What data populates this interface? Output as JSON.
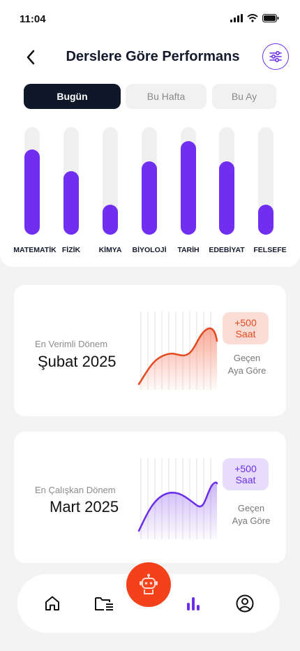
{
  "status_bar": {
    "time": "11:04"
  },
  "header": {
    "title": "Derslere Göre Performans"
  },
  "tabs": [
    {
      "label": "Bugün",
      "active": true
    },
    {
      "label": "Bu Hafta",
      "active": false
    },
    {
      "label": "Bu Ay",
      "active": false
    }
  ],
  "chart_data": {
    "type": "bar",
    "categories": [
      "MATEMATİK",
      "FİZİK",
      "KİMYA",
      "BİYOLOJİ",
      "TARİH",
      "EDEBİYAT",
      "FELSEFE"
    ],
    "values": [
      0.79,
      0.59,
      0.28,
      0.68,
      0.87,
      0.68,
      0.28
    ],
    "ylim": [
      0,
      1
    ],
    "color": "#6f2ef0"
  },
  "cards": [
    {
      "subtitle": "En Verimli Dönem",
      "value": "Şubat 2025",
      "badge_line1": "+500",
      "badge_line2": "Saat",
      "compare_line1": "Geçen",
      "compare_line2": "Aya Göre",
      "color": "#e34a1f"
    },
    {
      "subtitle": "En Çalışkan Dönem",
      "value": "Mart 2025",
      "badge_line1": "+500",
      "badge_line2": "Saat",
      "compare_line1": "Geçen",
      "compare_line2": "Aya Göre",
      "color": "#6b2ee8"
    }
  ],
  "nav": {
    "items": [
      "home-icon",
      "folder-list-icon",
      "robot-icon",
      "bar-chart-icon",
      "profile-icon"
    ],
    "active": "bar-chart-icon"
  }
}
